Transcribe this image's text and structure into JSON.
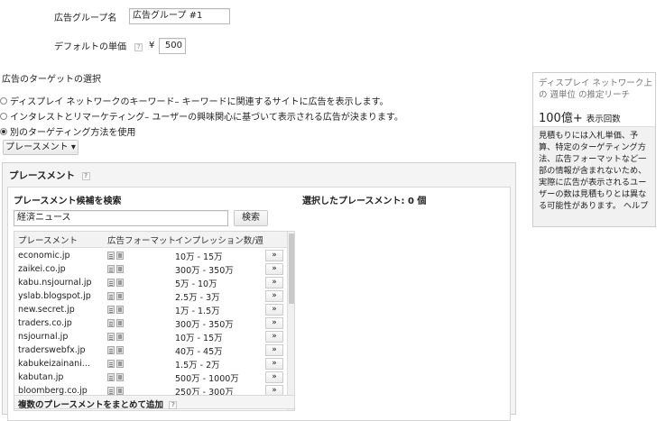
{
  "form": {
    "ad_group_name_label": "広告グループ名",
    "ad_group_name_value": "広告グループ #1",
    "default_bid_label": "デフォルトの単価",
    "currency_symbol": "¥",
    "default_bid_value": "500"
  },
  "targeting": {
    "section_title": "広告のターゲットの選択",
    "options": [
      {
        "label": "ディスプレイ ネットワークのキーワード– キーワードに関連するサイトに広告を表示します。",
        "selected": false
      },
      {
        "label": "インタレストとリマーケティング– ユーザーの興味関心に基づいて表示される広告が決まります。",
        "selected": false
      },
      {
        "label": "別のターゲティング方法を使用",
        "selected": true
      }
    ],
    "method_dropdown": "プレースメント ▾"
  },
  "placement": {
    "panel_title": "プレースメント",
    "search_title": "プレースメント候補を検索",
    "search_value": "経済ニュース",
    "search_button": "検索",
    "selected_label": "選択したプレースメント: 0 個",
    "columns": [
      "プレースメント",
      "広告フォーマット",
      "インプレッション数/週"
    ],
    "rows": [
      {
        "name": "economic.jp",
        "impressions": "10万 - 15万"
      },
      {
        "name": "zaikei.co.jp",
        "impressions": "300万 - 350万"
      },
      {
        "name": "kabu.nsjournal.jp",
        "impressions": "5万 - 10万"
      },
      {
        "name": "yslab.blogspot.jp",
        "impressions": "2.5万 - 3万"
      },
      {
        "name": "new.secret.jp",
        "impressions": "1万 - 1.5万"
      },
      {
        "name": "traders.co.jp",
        "impressions": "300万 - 350万"
      },
      {
        "name": "nsjournal.jp",
        "impressions": "10万 - 15万"
      },
      {
        "name": "traderswebfx.jp",
        "impressions": "40万 - 45万"
      },
      {
        "name": "kabukeizainani...",
        "impressions": "1.5万 - 2万"
      },
      {
        "name": "kabutan.jp",
        "impressions": "500万 - 1000万"
      },
      {
        "name": "bloomberg.co.jp",
        "impressions": "250万 - 300万"
      }
    ],
    "add_glyph": "»",
    "bulk_add_label": "複数のプレースメントをまとめて追加"
  },
  "reach": {
    "title": "ディスプレイ ネットワーク上の 週単位 の推定リーチ",
    "value": "100億+",
    "unit": "表示回数",
    "note": "見積もりには入札単価、予算、特定のターゲティング方法、広告フォーマットなど一部の情報が含まれないため、実際に広告が表示されるユーザーの数は見積もりとは異なる可能性があります。 ヘルプ"
  },
  "icons": {
    "help": "help-icon",
    "text_format": "text-ad-icon",
    "image_format": "image-ad-icon"
  }
}
